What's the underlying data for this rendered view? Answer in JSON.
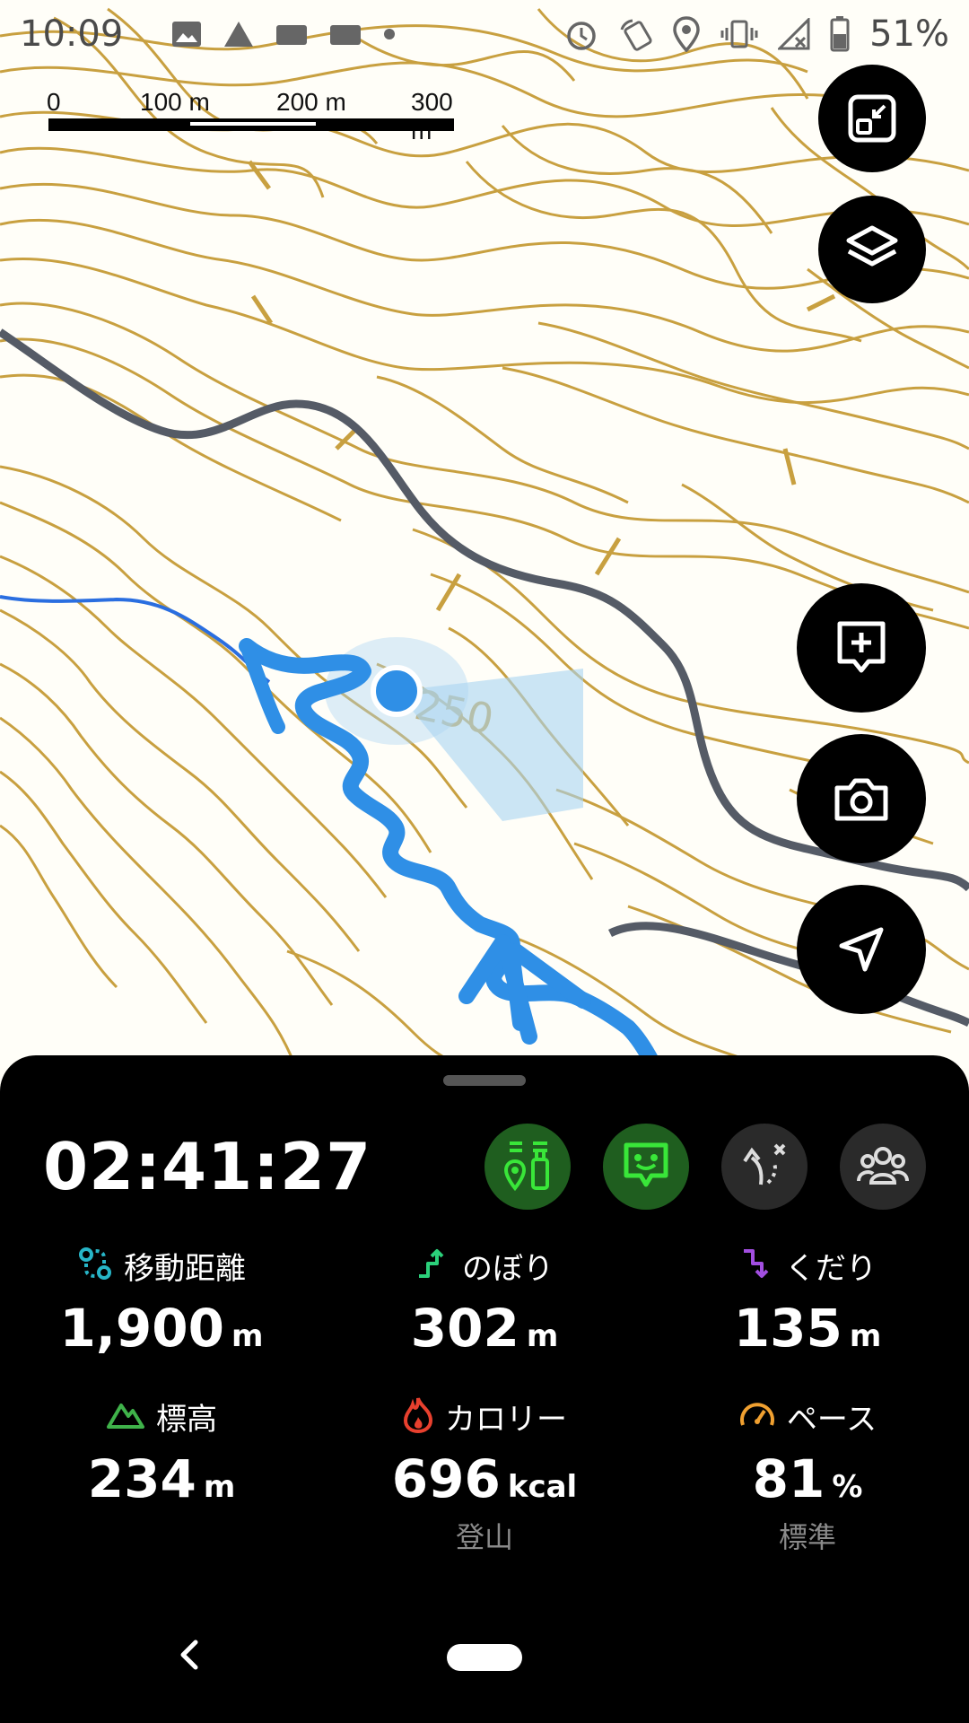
{
  "status_bar": {
    "time": "10:09",
    "battery_percent": "51%",
    "left_icons": [
      "gallery-icon",
      "signal-tower-icon",
      "app-badge-icon",
      "app-badge-icon",
      "dot-icon"
    ],
    "right_icons": [
      "alarm-icon",
      "nfc-icon",
      "location-icon",
      "vibrate-icon",
      "no-signal-icon",
      "battery-icon"
    ]
  },
  "scale_bar": {
    "labels": [
      "0",
      "100 m",
      "200 m",
      "300 m"
    ]
  },
  "map": {
    "contour_label": "250",
    "colors": {
      "contour": "#c8a040",
      "road": "#555b66",
      "track": "#2f8fe6",
      "river": "#2a6ee0",
      "position": "#2f8fe6"
    }
  },
  "map_buttons": [
    {
      "name": "fullscreen-exit",
      "icon": "fullscreen-exit-icon"
    },
    {
      "name": "layers",
      "icon": "layers-icon"
    },
    {
      "name": "add-memo",
      "icon": "add-memo-icon"
    },
    {
      "name": "camera",
      "icon": "camera-icon"
    },
    {
      "name": "navigate",
      "icon": "navigation-arrow-icon"
    }
  ],
  "activity": {
    "elapsed_time": "02:41:27",
    "mode_buttons": [
      {
        "name": "checkpoint",
        "icon": "map-pin-bottles-icon",
        "active": true
      },
      {
        "name": "chat",
        "icon": "chat-face-icon",
        "active": true
      },
      {
        "name": "route-off",
        "icon": "route-off-icon",
        "active": false
      },
      {
        "name": "group",
        "icon": "group-icon",
        "active": false
      }
    ],
    "stats": {
      "distance": {
        "label": "移動距離",
        "value": "1,900",
        "unit": "m",
        "icon": "route-icon",
        "color": "#27b5c7"
      },
      "ascent": {
        "label": "のぼり",
        "value": "302",
        "unit": "m",
        "icon": "ascent-icon",
        "color": "#2bd07a"
      },
      "descent": {
        "label": "くだり",
        "value": "135",
        "unit": "m",
        "icon": "descent-icon",
        "color": "#a24ee0"
      },
      "elevation": {
        "label": "標高",
        "value": "234",
        "unit": "m",
        "icon": "mountain-icon",
        "color": "#3fb24a"
      },
      "calories": {
        "label": "カロリー",
        "value": "696",
        "unit": "kcal",
        "sub": "登山",
        "icon": "flame-icon",
        "color": "#e8402e"
      },
      "pace": {
        "label": "ペース",
        "value": "81",
        "unit": "%",
        "sub": "標準",
        "icon": "speedometer-icon",
        "color": "#f0a030"
      }
    }
  },
  "nav_bar": {
    "back": "back-icon",
    "home": "home-pill"
  }
}
